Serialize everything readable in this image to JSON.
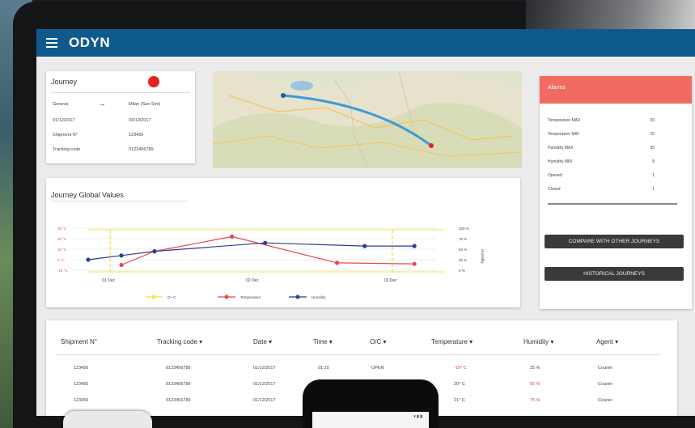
{
  "app": {
    "title": "ODYN"
  },
  "journey": {
    "title": "Journey",
    "rows": [
      {
        "label": "Geneva",
        "value": "Milan (San Siro)"
      },
      {
        "label": "01/12/2017",
        "value": "03/12/2017"
      },
      {
        "label": "Shipment N°",
        "value": "123456"
      },
      {
        "label": "Tracking code",
        "value": "0123456789"
      }
    ],
    "arrow": "→"
  },
  "alarms": {
    "title": "Alarms",
    "rows": [
      {
        "label": "Temperature MAX",
        "value": "20"
      },
      {
        "label": "Temperature MIN",
        "value": "15"
      },
      {
        "label": "Humidity MAX",
        "value": "35"
      },
      {
        "label": "Humidity MIN",
        "value": "8"
      },
      {
        "label": "Opened",
        "value": "1"
      },
      {
        "label": "Closed",
        "value": "1"
      }
    ],
    "compare_button": "COMPARE WITH OTHER JOURNEYS",
    "historical_button": "HISTORICAL JOURNEYS"
  },
  "chart_data": {
    "type": "line",
    "title": "Journey Global Values",
    "x": [
      1,
      1.6,
      2,
      2.2,
      2.4,
      3.5,
      4.2,
      6.0,
      6.6,
      7.0
    ],
    "x_tick_labels": [
      "01 Dec",
      "02 Dec",
      "03 Dec"
    ],
    "y_left_ticks": [
      "-10 °C",
      "0 °C",
      "10 °C",
      "20 °C",
      "30 °C"
    ],
    "y_right_ticks": [
      "0 %",
      "25 %",
      "50 %",
      "75 %",
      "100 %"
    ],
    "y_right_label": "Humidity",
    "series": [
      {
        "name": "Temperature",
        "color": "#e8484a",
        "points": [
          [
            1.6,
            5
          ],
          [
            2.2,
            18
          ],
          [
            3.6,
            32
          ],
          [
            5.5,
            7
          ],
          [
            6.9,
            6
          ]
        ]
      },
      {
        "name": "Humidity",
        "color": "#2b3f8f",
        "points": [
          [
            1.0,
            10
          ],
          [
            1.6,
            14
          ],
          [
            2.2,
            18
          ],
          [
            4.2,
            26
          ],
          [
            6.0,
            23
          ],
          [
            6.9,
            23
          ]
        ]
      }
    ],
    "legend": [
      {
        "label": "O / C",
        "color": "#f2e34b"
      },
      {
        "label": "Temperature",
        "color": "#e8484a"
      },
      {
        "label": "Humidity",
        "color": "#2b3f8f"
      }
    ]
  },
  "table": {
    "headers": [
      "Shipment N°",
      "Tracking code ▾",
      "Date ▾",
      "Time ▾",
      "O/C ▾",
      "Temperature ▾",
      "Humidity ▾",
      "Agent ▾"
    ],
    "rows": [
      [
        "123456",
        "0123456789",
        "01/12/2017",
        "01:15",
        "OPEN",
        "-19° C",
        "25 %",
        "Courier"
      ],
      [
        "123456",
        "0123456789",
        "01/12/2017",
        "",
        "",
        "20° C",
        "55 %",
        "Courier"
      ],
      [
        "123456",
        "0123456789",
        "01/12/2017",
        "",
        "",
        "21° C",
        "75 %",
        "Courier"
      ]
    ]
  },
  "colors": {
    "appbar": "#0f5a8c",
    "alarm_header": "#f26b63",
    "status_dot": "#e2231a"
  }
}
